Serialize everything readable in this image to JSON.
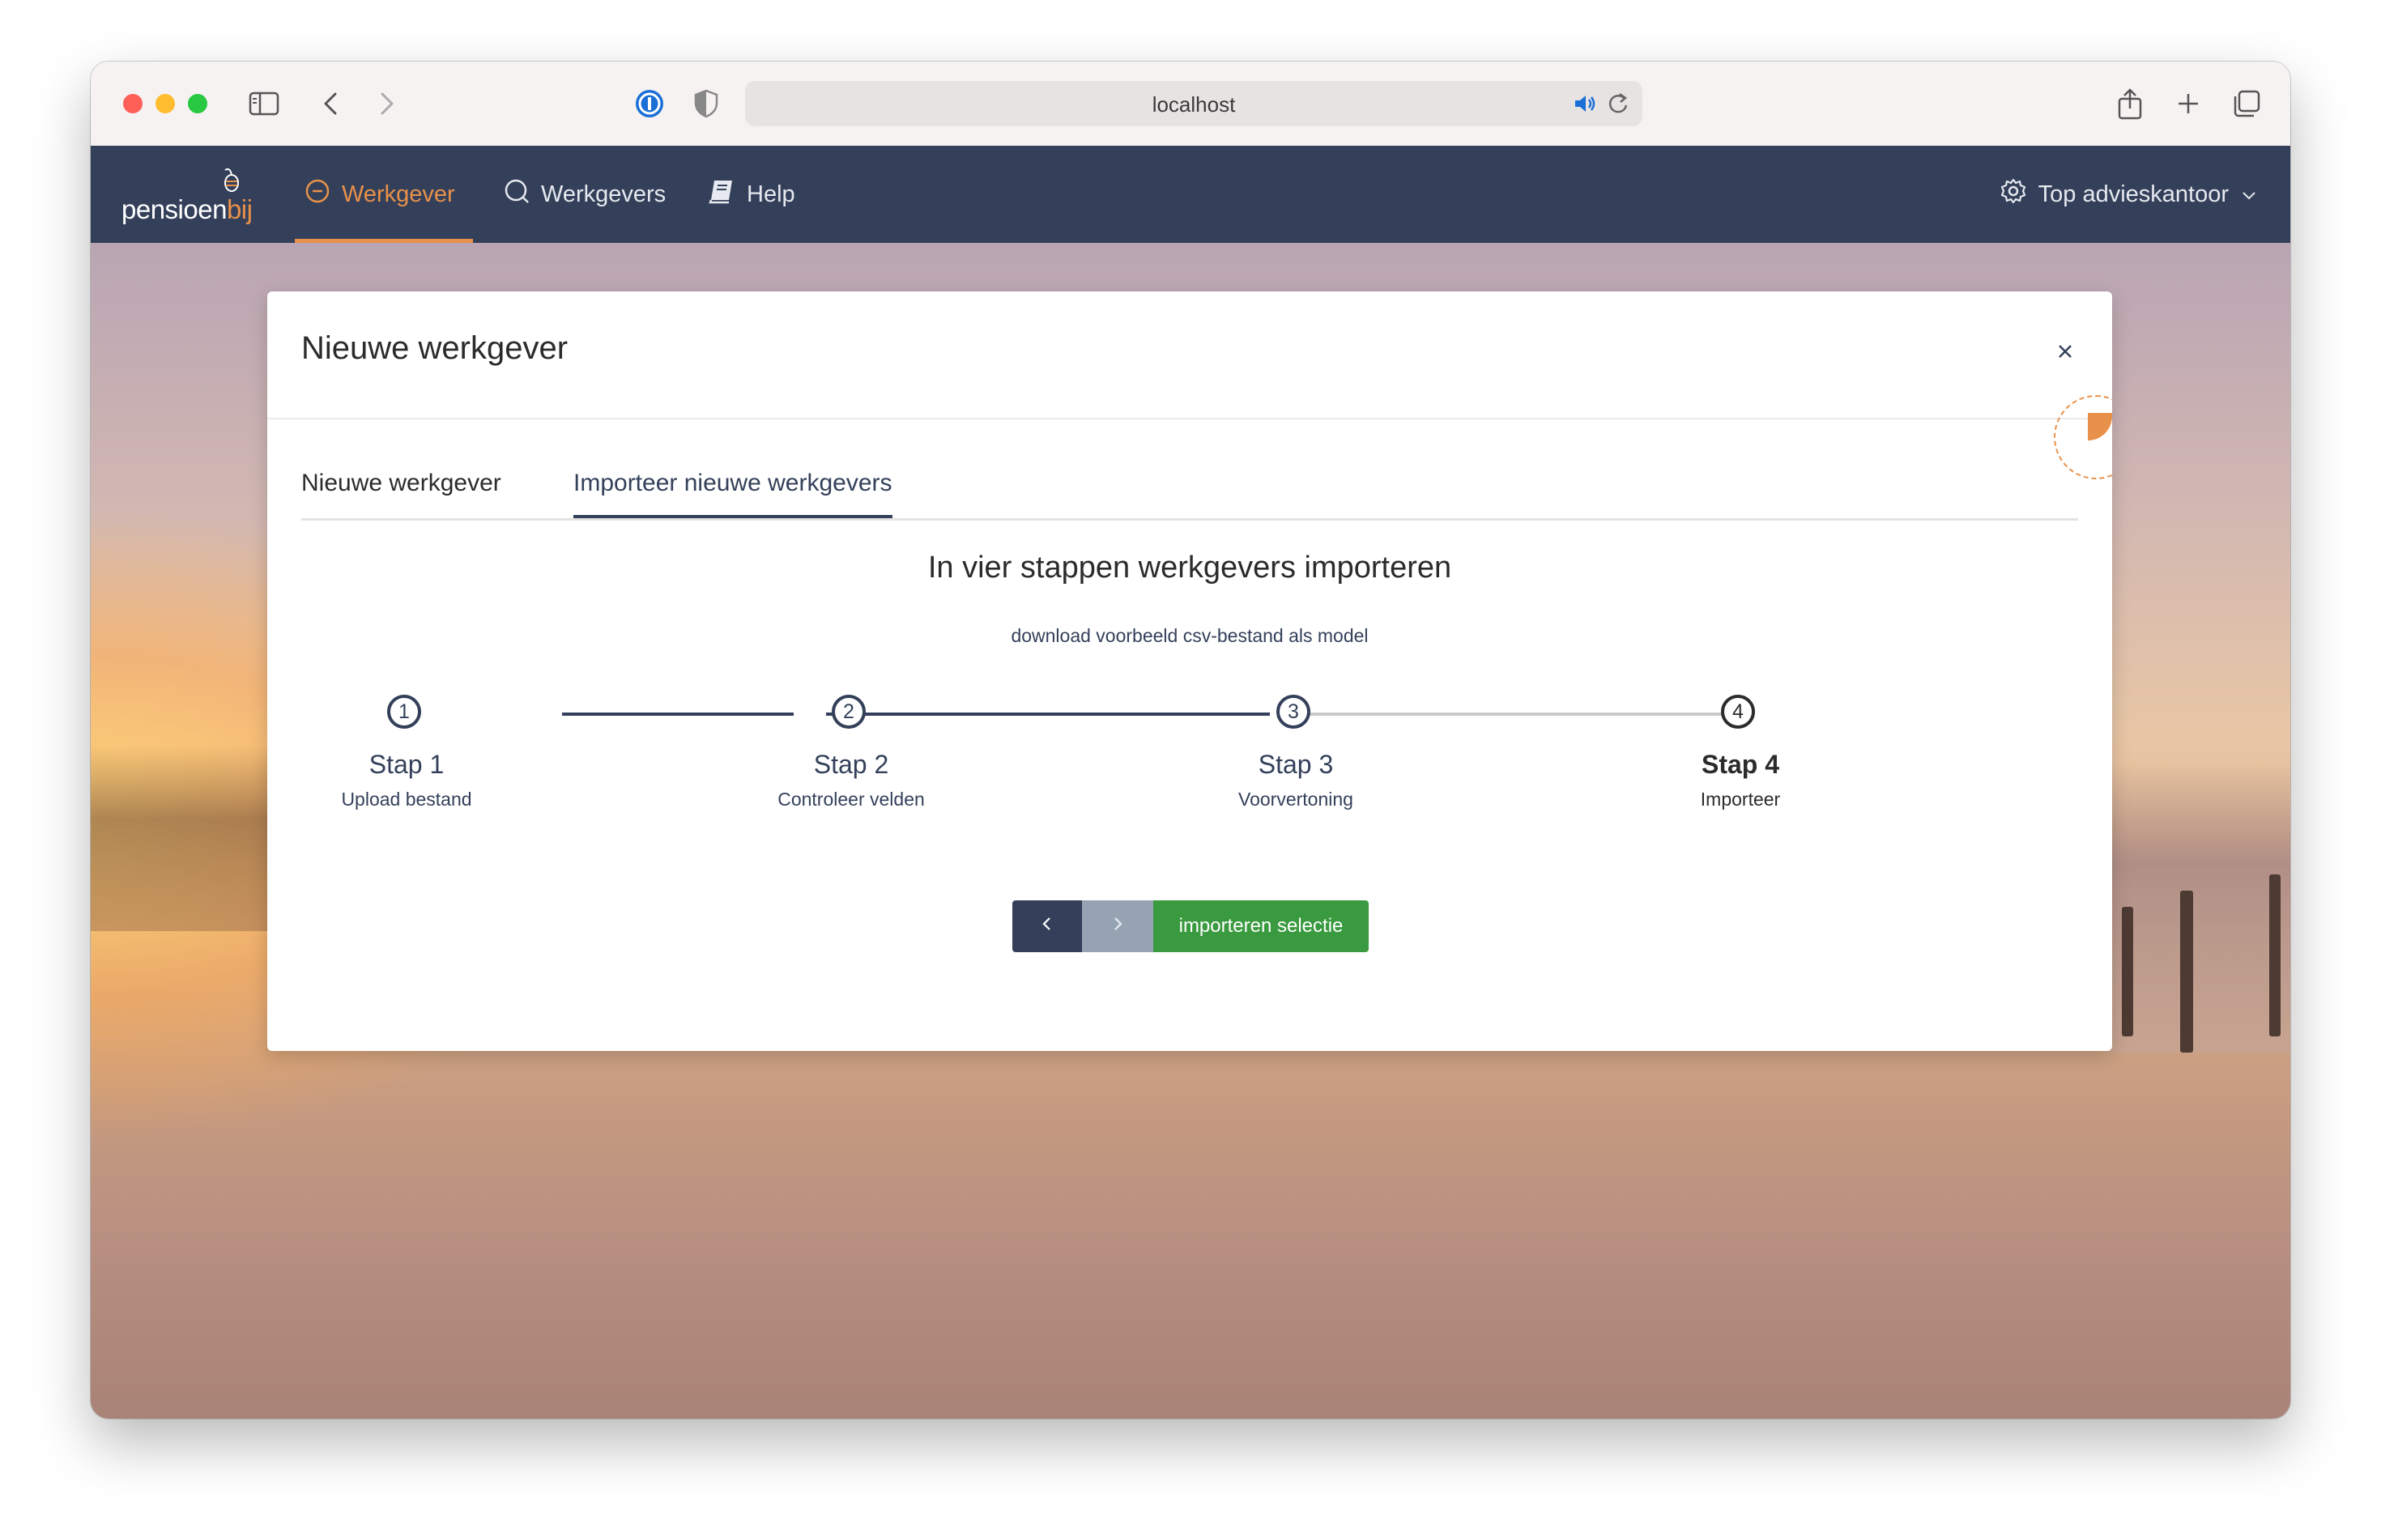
{
  "browser": {
    "url": "localhost",
    "icons": [
      "sidebar-icon",
      "back-icon",
      "forward-icon",
      "password-icon",
      "shield-icon",
      "speaker-icon",
      "reload-icon",
      "share-icon",
      "new-tab-icon",
      "tab-overview-icon"
    ]
  },
  "nav": {
    "logo": {
      "text_main": "pensioen",
      "text_accent": "bij"
    },
    "items": [
      {
        "label": "Werkgever",
        "icon": "minus-circle-icon",
        "active": true
      },
      {
        "label": "Werkgevers",
        "icon": "search-icon",
        "active": false
      },
      {
        "label": "Help",
        "icon": "book-icon",
        "active": false
      }
    ],
    "account": {
      "label": "Top advieskantoor",
      "icon": "gear-icon"
    }
  },
  "modal": {
    "title": "Nieuwe werkgever",
    "tabs": [
      {
        "label": "Nieuwe werkgever",
        "active": false
      },
      {
        "label": "Importeer nieuwe werkgevers",
        "active": true
      }
    ],
    "heading": "In vier stappen werkgevers importeren",
    "download_link": "download voorbeeld csv-bestand als model",
    "steps": [
      {
        "number": "1",
        "title": "Stap 1",
        "subtitle": "Upload bestand",
        "state": "done"
      },
      {
        "number": "2",
        "title": "Stap 2",
        "subtitle": "Controleer velden",
        "state": "done"
      },
      {
        "number": "3",
        "title": "Stap 3",
        "subtitle": "Voorvertoning",
        "state": "done"
      },
      {
        "number": "4",
        "title": "Stap 4",
        "subtitle": "Importeer",
        "state": "current"
      }
    ],
    "buttons": {
      "import_label": "importeren selectie"
    }
  },
  "colors": {
    "nav_bg": "#34405a",
    "accent": "#e8914a",
    "primary": "#34405a",
    "success": "#3a9a3f",
    "disabled": "#95a3b3"
  }
}
